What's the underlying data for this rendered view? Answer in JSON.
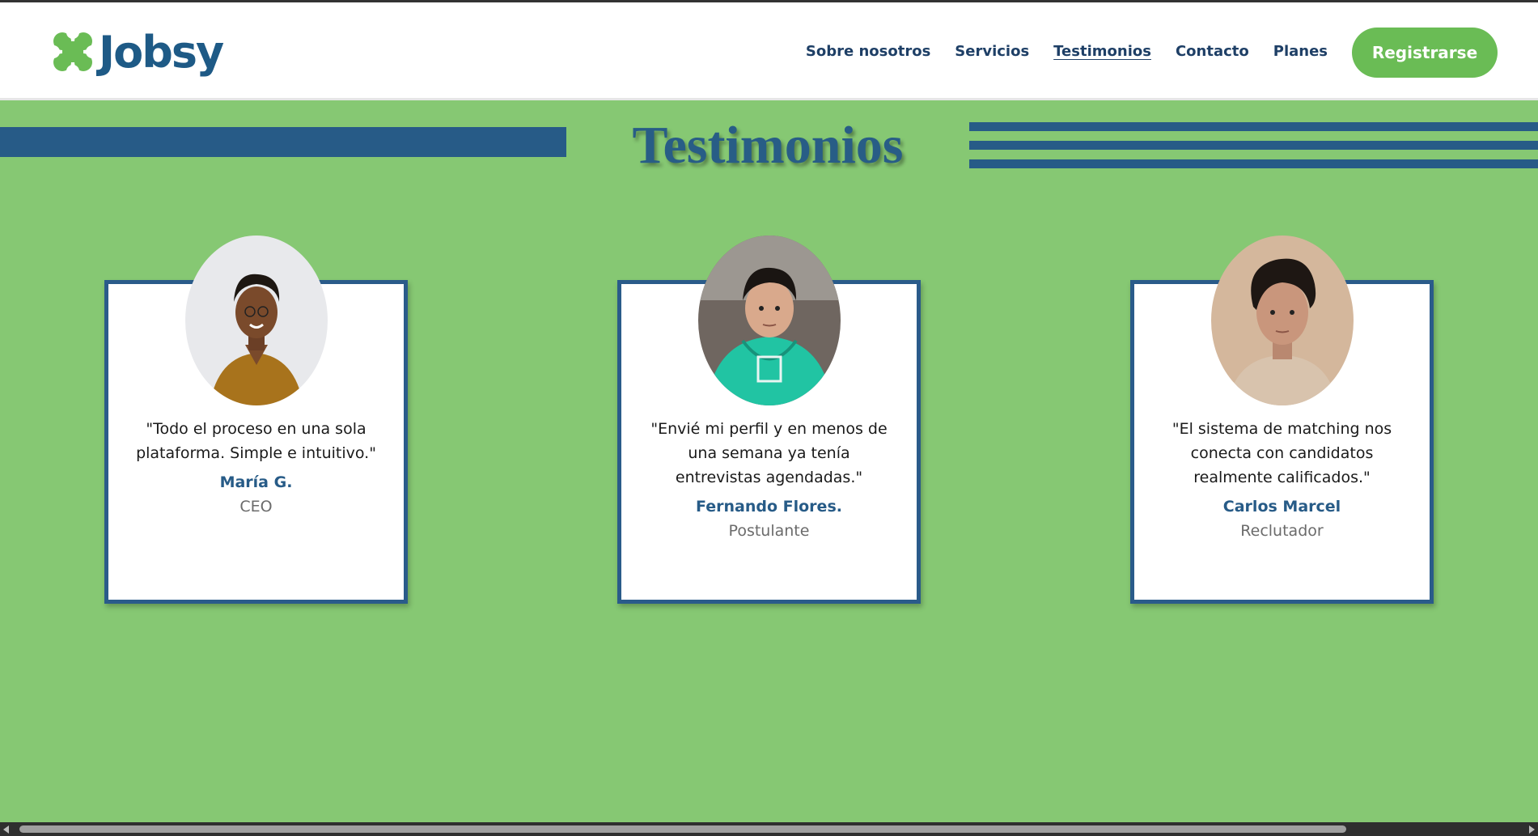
{
  "brand": {
    "name": "Jobsy",
    "logo_icon": "jobsy-logo-icon",
    "color_primary": "#1e5a86",
    "color_accent": "#6abc55"
  },
  "nav": {
    "items": [
      {
        "label": "Sobre nosotros"
      },
      {
        "label": "Servicios"
      },
      {
        "label": "Testimonios",
        "active": true
      },
      {
        "label": "Contacto"
      },
      {
        "label": "Planes"
      }
    ],
    "register_label": "Registrarse"
  },
  "section": {
    "title": "Testimonios",
    "background": "#86c873"
  },
  "testimonials": [
    {
      "quote": "\"Todo el proceso en una sola plataforma. Simple e intuitivo.\"",
      "author": "María G.",
      "role": "CEO",
      "photo": "avatar-photo-woman"
    },
    {
      "quote": "\"Envié mi perfil y en menos de una semana ya tenía entrevistas agendadas.\"",
      "author": "Fernando Flores.",
      "role": "Postulante",
      "photo": "avatar-photo-boy-hoodie"
    },
    {
      "quote": "\"El sistema de matching nos conecta con candidatos realmente calificados.\"",
      "author": "Carlos Marcel",
      "role": "Reclutador",
      "photo": "avatar-photo-man"
    }
  ]
}
